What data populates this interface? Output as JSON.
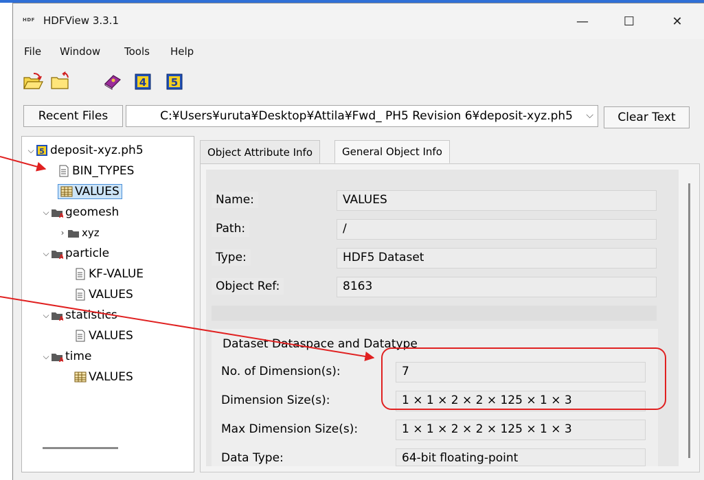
{
  "window": {
    "app_icon_text": "HDF",
    "title": "HDFView 3.3.1",
    "minimize_glyph": "—",
    "maximize_glyph": "☐",
    "close_glyph": "✕"
  },
  "menu": {
    "file": "File",
    "window": "Window",
    "tools": "Tools",
    "help": "Help"
  },
  "toolbar": {
    "icons": [
      "open-folder-icon",
      "new-folder-icon",
      "help-book-icon",
      "hdf4-icon",
      "hdf5-icon"
    ],
    "hdf4_label": "4",
    "hdf5_label": "5"
  },
  "filebar": {
    "recent_files_label": "Recent Files",
    "path_value": "C:¥Users¥uruta¥Desktop¥Attila¥Fwd_ PH5 Revision 6¥deposit-xyz.ph5",
    "clear_text_label": "Clear Text"
  },
  "tree": {
    "root": "deposit-xyz.ph5",
    "bin_types": "BIN_TYPES",
    "values_root": "VALUES",
    "geomesh": "geomesh",
    "xyz": "xyz",
    "particle": "particle",
    "kf_value": "KF-VALUE",
    "particle_values": "VALUES",
    "statistics": "statistics",
    "statistics_values": "VALUES",
    "time": "time",
    "time_values": "VALUES"
  },
  "tabs": {
    "attribute_info": "Object Attribute Info",
    "general_info": "General Object Info"
  },
  "general": {
    "name_label": "Name:",
    "name_value": "VALUES",
    "path_label": "Path:",
    "path_value": "/",
    "type_label": "Type:",
    "type_value": "HDF5 Dataset",
    "objref_label": "Object Ref:",
    "objref_value": "8163"
  },
  "dataspace": {
    "group_title": "Dataset Dataspace and Datatype",
    "ndims_label": "No. of Dimension(s):",
    "ndims_value": "7",
    "dimsize_label": "Dimension Size(s):",
    "dimsize_value": "1 × 1 × 2 × 2 × 125 × 1 × 3",
    "maxdim_label": "Max Dimension Size(s):",
    "maxdim_value": "1 × 1 × 2 × 2 × 125 × 1 × 3",
    "dtype_label": "Data Type:",
    "dtype_value": "64-bit floating-point"
  },
  "annotation": {
    "color": "#e02020"
  }
}
